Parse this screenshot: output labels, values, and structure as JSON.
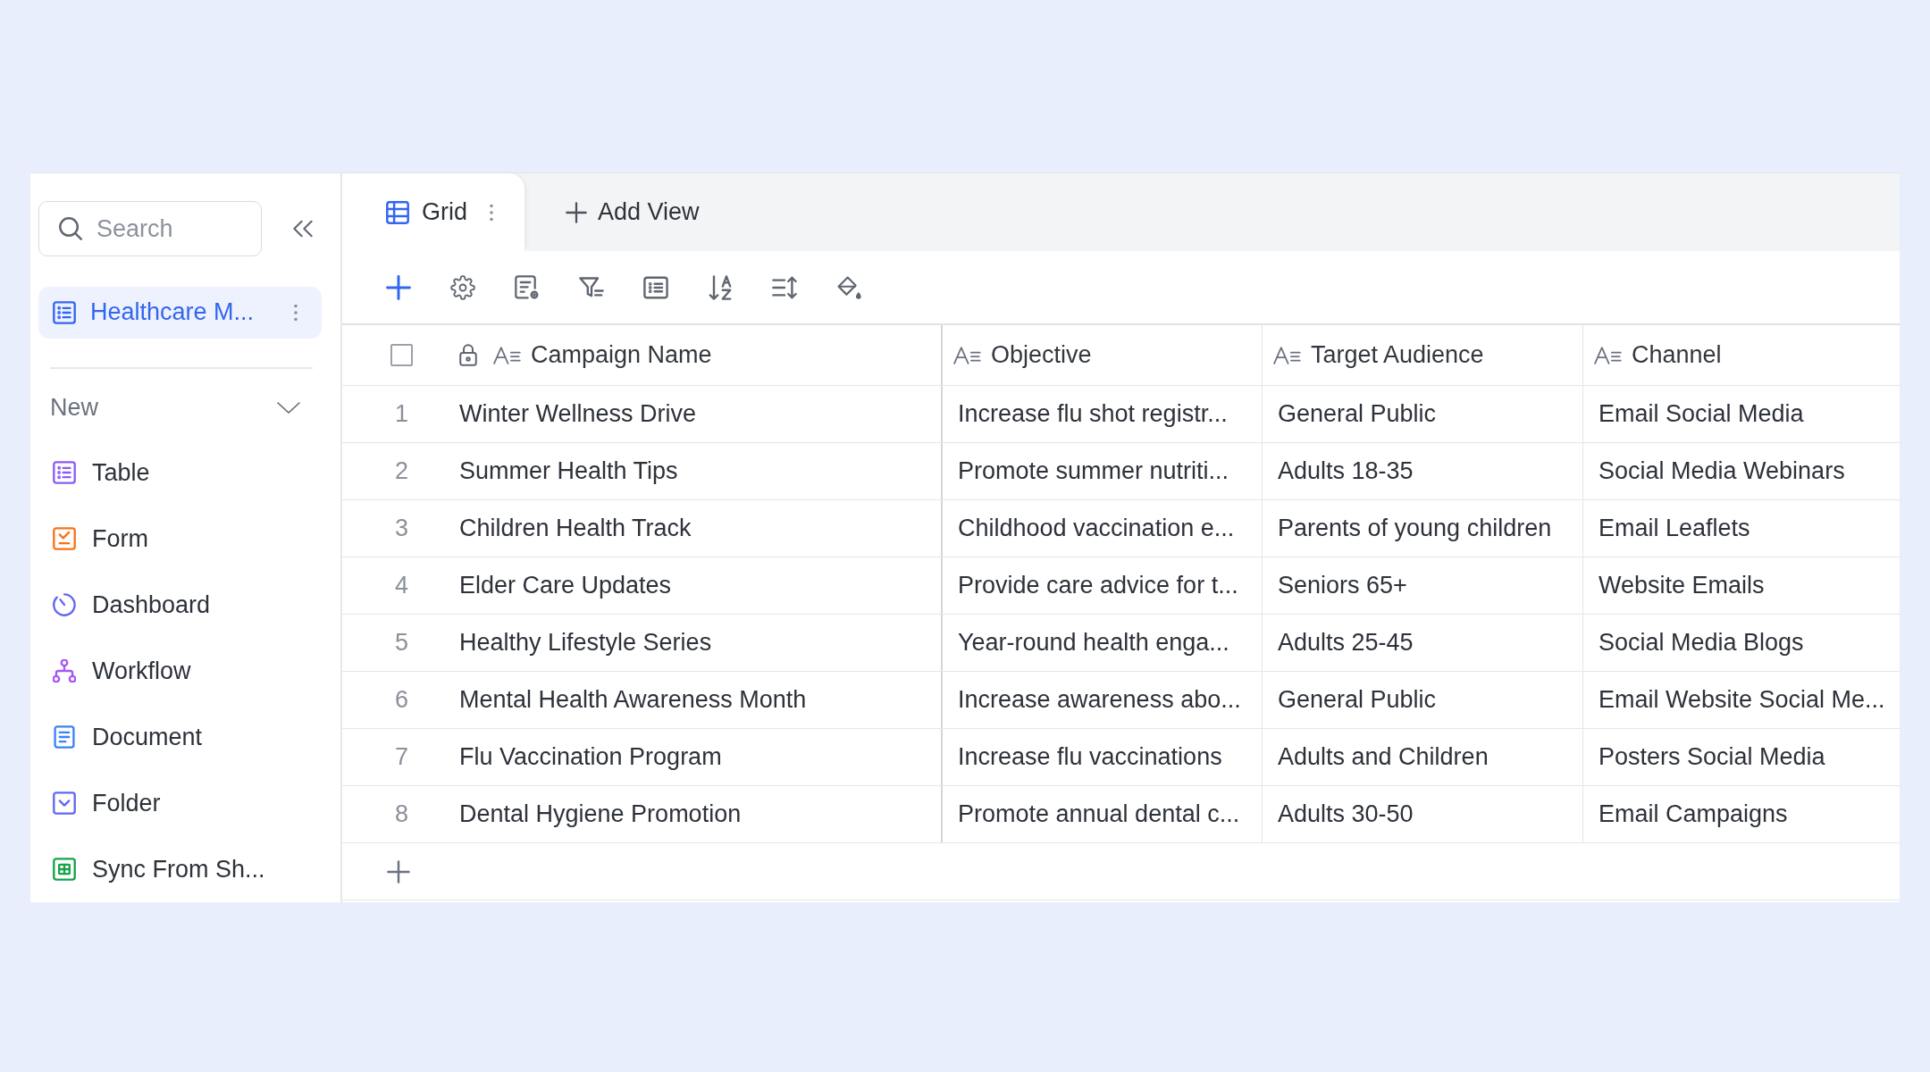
{
  "sidebar": {
    "search": {
      "placeholder": "Search"
    },
    "pages": [
      {
        "label": "Healthcare M...",
        "selected": true
      }
    ],
    "new_menu": {
      "label": "New",
      "expanded": true,
      "items": [
        {
          "label": "Table",
          "kind": "table"
        },
        {
          "label": "Form",
          "kind": "form"
        },
        {
          "label": "Dashboard",
          "kind": "dashboard"
        },
        {
          "label": "Workflow",
          "kind": "workflow"
        },
        {
          "label": "Document",
          "kind": "document"
        },
        {
          "label": "Folder",
          "kind": "folder"
        },
        {
          "label": "Sync From Sh...",
          "kind": "sync"
        }
      ]
    }
  },
  "views": {
    "tabs": [
      {
        "label": "Grid",
        "selected": true
      }
    ],
    "add_view": "Add View"
  },
  "table": {
    "header_checkbox": {
      "checked": false
    },
    "columns": [
      {
        "label": "Campaign Name",
        "locked": true
      },
      {
        "label": "Objective",
        "locked": false
      },
      {
        "label": "Target Audience",
        "locked": false
      },
      {
        "label": "Channel",
        "locked": false
      }
    ],
    "rows": [
      {
        "number": "1",
        "cells": [
          "Winter Wellness Drive",
          "Increase flu shot registr...",
          "General Public",
          "Email Social Media"
        ]
      },
      {
        "number": "2",
        "cells": [
          "Summer Health Tips",
          "Promote summer nutriti...",
          "Adults 18-35",
          "Social Media Webinars"
        ]
      },
      {
        "number": "3",
        "cells": [
          "Children Health Track",
          "Childhood vaccination e...",
          "Parents of young children",
          "Email Leaflets"
        ]
      },
      {
        "number": "4",
        "cells": [
          "Elder Care Updates",
          "Provide care advice for t...",
          "Seniors 65+",
          "Website Emails"
        ]
      },
      {
        "number": "5",
        "cells": [
          "Healthy Lifestyle Series",
          "Year-round health enga...",
          "Adults 25-45",
          "Social Media Blogs"
        ]
      },
      {
        "number": "6",
        "cells": [
          "Mental Health Awareness Month",
          "Increase awareness abo...",
          "General Public",
          "Email Website Social Me..."
        ]
      },
      {
        "number": "7",
        "cells": [
          "Flu Vaccination Program",
          "Increase flu vaccinations",
          "Adults and Children",
          "Posters Social Media"
        ]
      },
      {
        "number": "8",
        "cells": [
          "Dental Hygiene Promotion",
          "Promote annual dental c...",
          "Adults 30-50",
          "Email Campaigns"
        ]
      }
    ]
  }
}
